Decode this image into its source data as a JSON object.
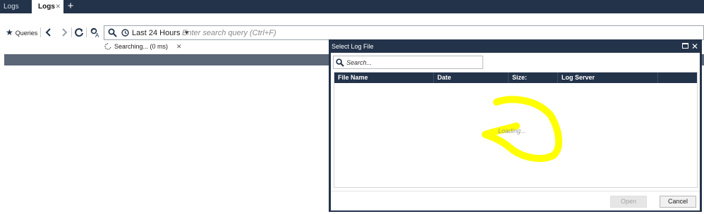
{
  "tabs": [
    {
      "label": "Logs",
      "active": false
    },
    {
      "label": "Logs",
      "active": true
    }
  ],
  "toolbar": {
    "queries_label": "Queries",
    "time_range": "Last 24 Hours",
    "search_placeholder": "Enter search query (Ctrl+F)"
  },
  "status": {
    "text": "Searching... (0 ms)"
  },
  "dialog": {
    "title": "Select Log File",
    "search_placeholder": "Search...",
    "columns": [
      "File Name",
      "Date",
      "Size:",
      "Log Server"
    ],
    "loading_text": "Loading...",
    "open_label": "Open",
    "cancel_label": "Cancel"
  },
  "colors": {
    "header_navy": "#23334a",
    "grid_band": "#5b6676",
    "scribble_yellow": "#ffff00"
  },
  "icons": [
    "star-icon",
    "back-icon",
    "forward-icon",
    "refresh-icon",
    "query-options-icon",
    "search-icon",
    "clock-icon",
    "spinner-icon",
    "maximize-icon",
    "close-icon",
    "add-tab-icon"
  ]
}
